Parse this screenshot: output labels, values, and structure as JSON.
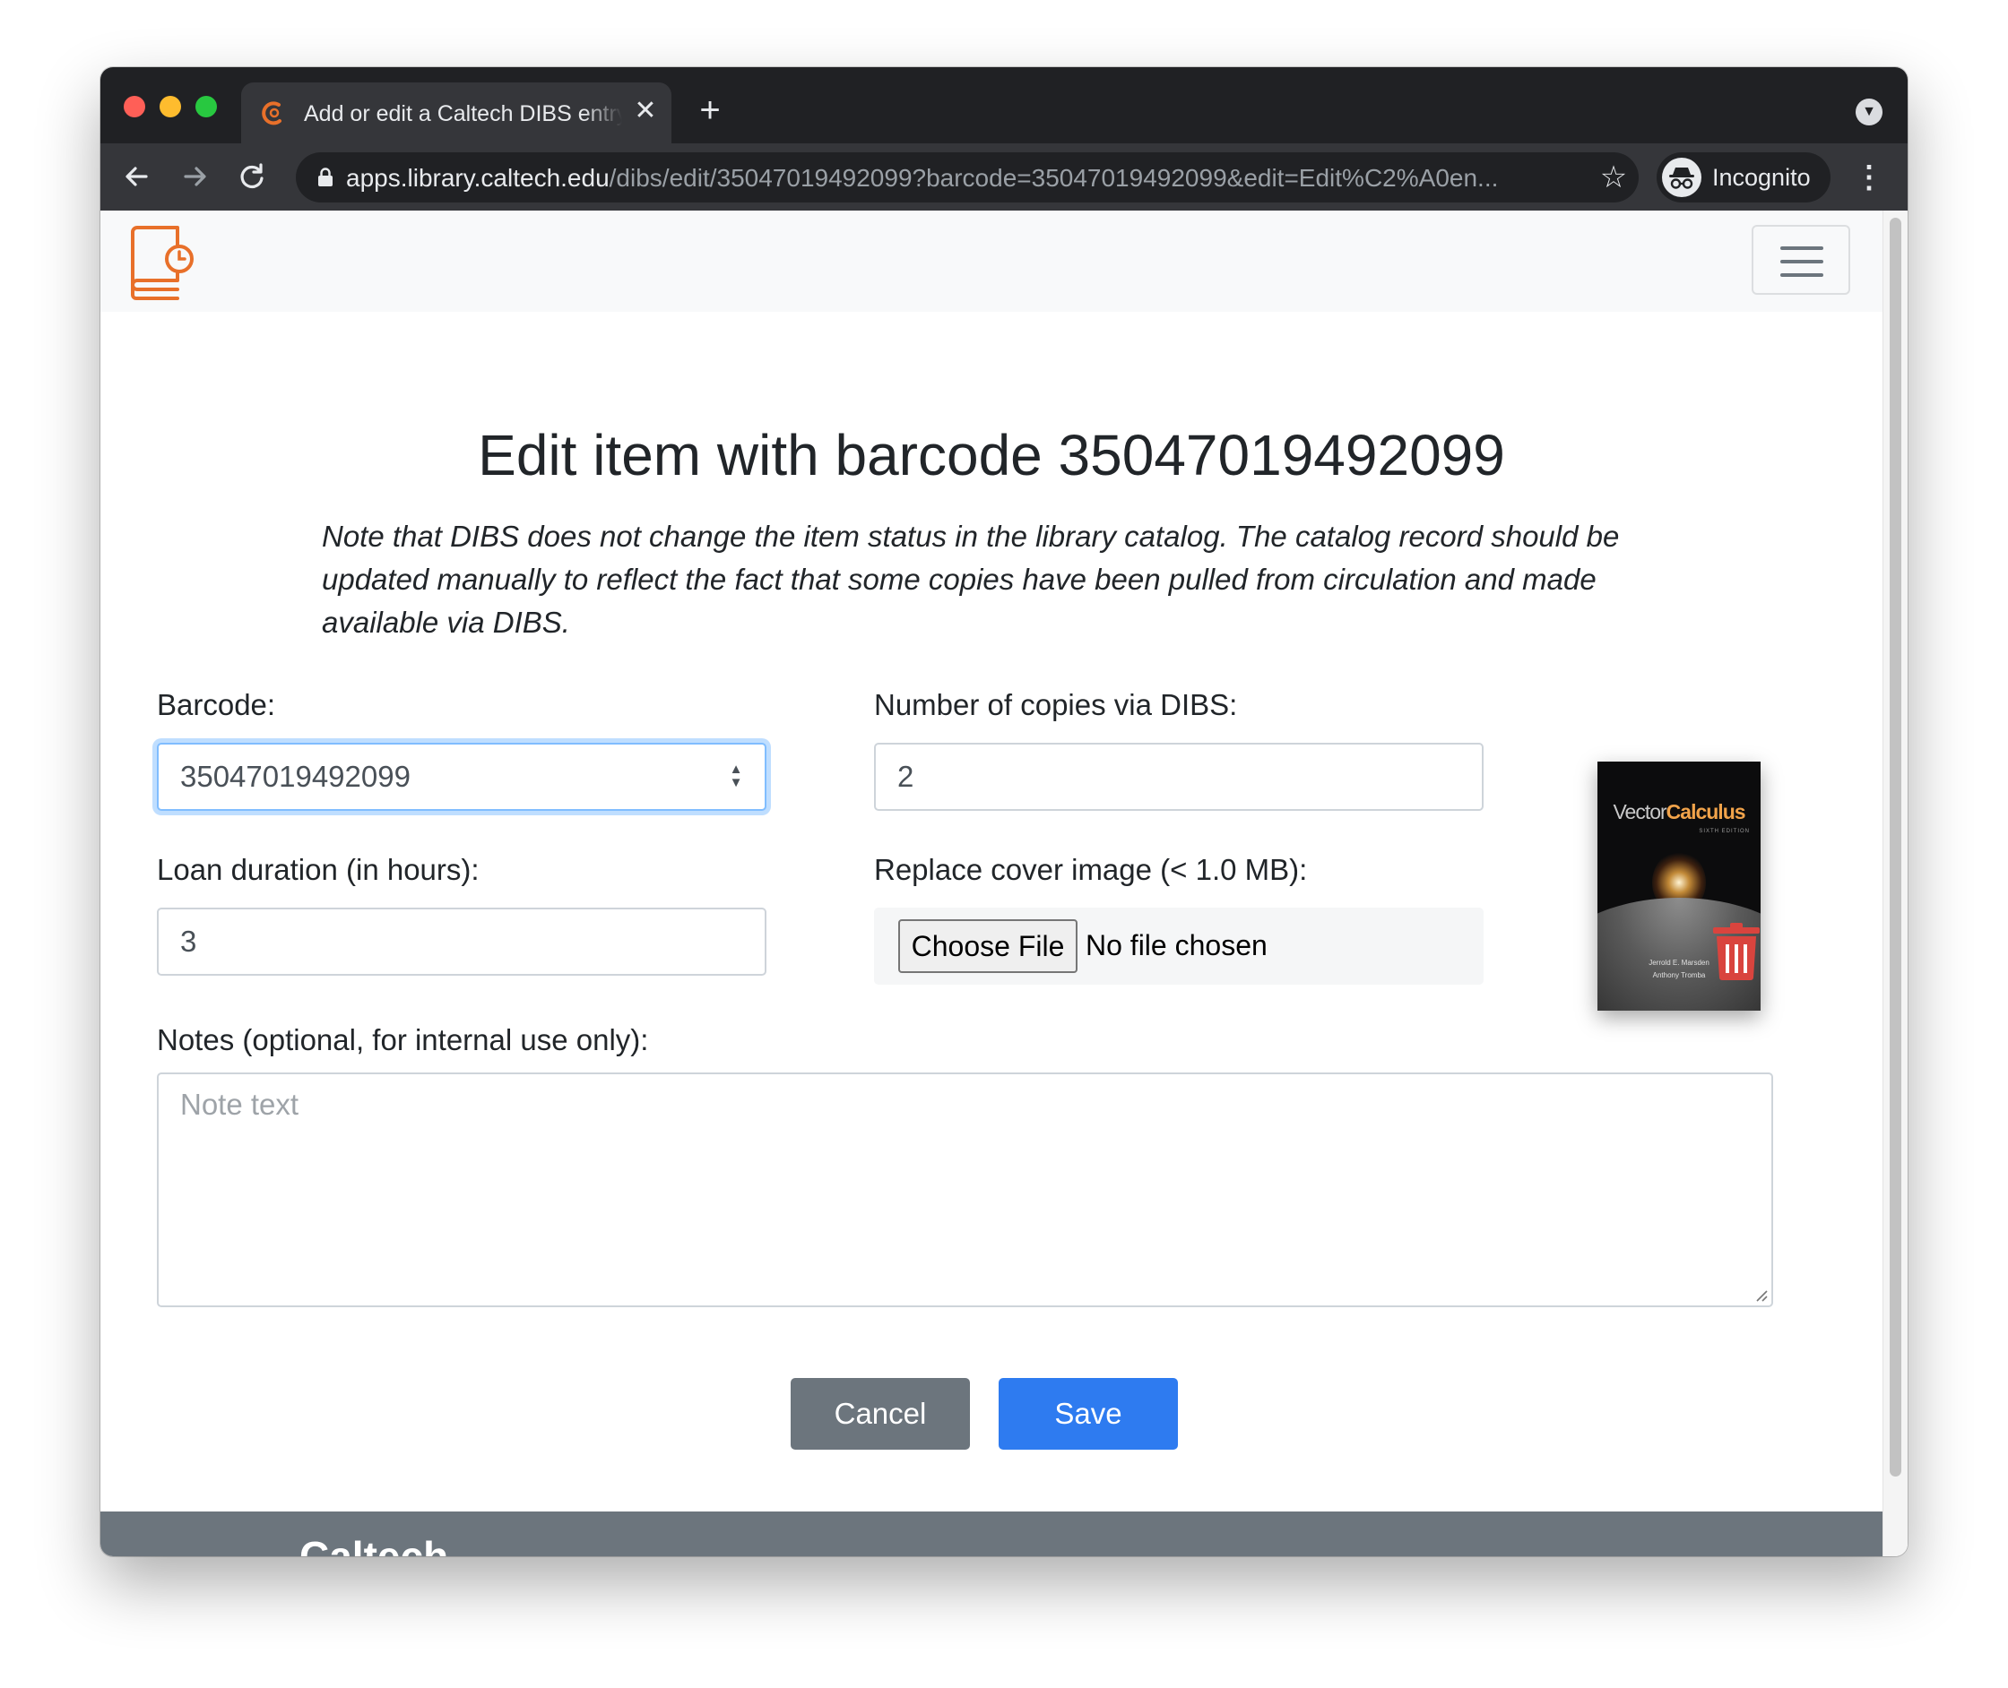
{
  "browser": {
    "tab_title": "Add or edit a Caltech DIBS entry",
    "tab_close": "✕",
    "new_tab": "+",
    "url_host": "apps.library.caltech.edu",
    "url_path": "/dibs/edit/35047019492099?barcode=35047019492099&edit=Edit%C2%A0en...",
    "profile_label": "Incognito",
    "icons": [
      "back-icon",
      "forward-icon",
      "reload-icon",
      "lock-icon",
      "star-icon",
      "incognito-icon",
      "more-menu-icon",
      "tab-search-icon"
    ]
  },
  "navbar": {
    "logo": "dibs-book-clock-logo",
    "menu_icon": "hamburger-menu-icon"
  },
  "page": {
    "title": "Edit item with barcode 35047019492099",
    "note": "Note that DIBS does not change the item status in the library catalog. The catalog record should be updated manually to reflect the fact that some copies have been pulled from circulation and made available via DIBS."
  },
  "form": {
    "barcode_label": "Barcode:",
    "barcode_value": "35047019492099",
    "copies_label": "Number of copies via DIBS:",
    "copies_value": "2",
    "duration_label": "Loan duration (in hours):",
    "duration_value": "3",
    "cover_label": "Replace cover image (< 1.0 MB):",
    "choose_file_label": "Choose File",
    "file_status": "No file chosen",
    "notes_label": "Notes (optional, for internal use only):",
    "notes_placeholder": "Note text",
    "cancel_label": "Cancel",
    "save_label": "Save"
  },
  "cover": {
    "title_part1": "Vector",
    "title_part2": "Calculus",
    "edition": "SIXTH EDITION",
    "author1": "Jerrold E. Marsden",
    "author2": "Anthony Tromba",
    "delete_icon": "trash-icon"
  },
  "footer": {
    "brand": "Caltech"
  },
  "colors": {
    "primary": "#2e7bf0",
    "secondary": "#6c757d",
    "brand_orange": "#e8702a",
    "danger": "#dc3545"
  }
}
